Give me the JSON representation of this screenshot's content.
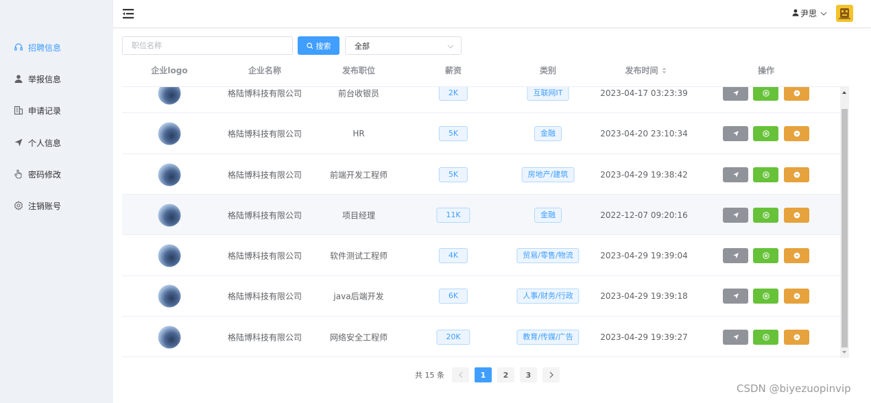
{
  "sidebar": {
    "items": [
      {
        "label": "招聘信息",
        "icon": "headset-icon",
        "active": true
      },
      {
        "label": "举报信息",
        "icon": "user-icon",
        "active": false
      },
      {
        "label": "申请记录",
        "icon": "document-icon",
        "active": false
      },
      {
        "label": "个人信息",
        "icon": "send-icon",
        "active": false
      },
      {
        "label": "密码修改",
        "icon": "hand-icon",
        "active": false
      },
      {
        "label": "注销账号",
        "icon": "gear-icon",
        "active": false
      }
    ]
  },
  "header": {
    "user_name": "尹思"
  },
  "filters": {
    "search_placeholder": "职位名称",
    "search_value": "",
    "search_button": "搜索",
    "category_selected": "全部"
  },
  "table": {
    "columns": [
      "企业logo",
      "企业名称",
      "发布职位",
      "薪资",
      "类别",
      "发布时间",
      "操作"
    ],
    "rows": [
      {
        "company": "格陆博科技有限公司",
        "position": "前台收银员",
        "salary": "2K",
        "category": "互联网IT",
        "time": "2023-04-17 03:23:39"
      },
      {
        "company": "格陆博科技有限公司",
        "position": "HR",
        "salary": "5K",
        "category": "金融",
        "time": "2023-04-20 23:10:34"
      },
      {
        "company": "格陆博科技有限公司",
        "position": "前端开发工程师",
        "salary": "5K",
        "category": "房地产/建筑",
        "time": "2023-04-29 19:38:42"
      },
      {
        "company": "格陆博科技有限公司",
        "position": "项目经理",
        "salary": "11K",
        "category": "金融",
        "time": "2022-12-07 09:20:16"
      },
      {
        "company": "格陆博科技有限公司",
        "position": "软件测试工程师",
        "salary": "4K",
        "category": "贸易/零售/物流",
        "time": "2023-04-29 19:39:04"
      },
      {
        "company": "格陆博科技有限公司",
        "position": "java后端开发",
        "salary": "6K",
        "category": "人事/财务/行政",
        "time": "2023-04-29 19:39:18"
      },
      {
        "company": "格陆博科技有限公司",
        "position": "网络安全工程师",
        "salary": "20K",
        "category": "教育/传媒/广告",
        "time": "2023-04-29 19:39:27"
      }
    ]
  },
  "pagination": {
    "total_text": "共 15 条",
    "pages": [
      "1",
      "2",
      "3"
    ],
    "current": "1"
  },
  "watermark": "CSDN @biyezuopinvip",
  "colors": {
    "primary": "#409eff",
    "gray_button": "#909399",
    "green_button": "#67c23a",
    "orange_button": "#e6a23c",
    "sidebar_bg": "#eef1f6"
  }
}
